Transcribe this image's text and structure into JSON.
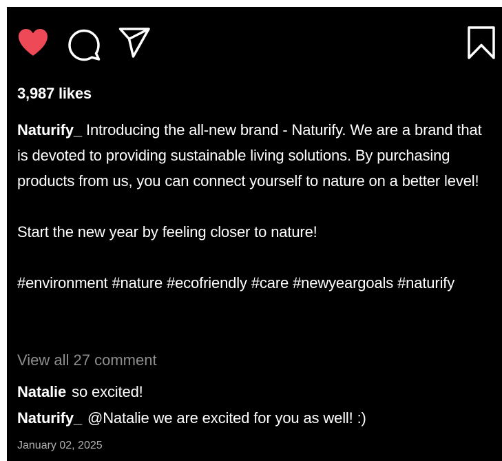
{
  "post": {
    "colors": {
      "background": "#000000",
      "text": "#ffffff",
      "muted": "#8e8e8e",
      "heart": "#ed4956"
    },
    "actions": {
      "like_icon": "heart-icon",
      "liked": true,
      "comment_icon": "comment-bubble-icon",
      "share_icon": "paper-plane-icon",
      "save_icon": "bookmark-icon"
    },
    "likes_text": "3,987 likes",
    "caption": {
      "username": "Naturify_",
      "paragraph_1": "Introducing the all-new brand - Naturify. We are a brand that is devoted to providing sustainable living solutions. By purchasing products from us, you can connect yourself to nature on a better level!",
      "paragraph_2": "Start the new year by feeling closer to nature!",
      "hashtags": [
        "#environment",
        "#nature",
        "#ecofriendly",
        "#care",
        "#newyeargoals",
        "#naturify"
      ]
    },
    "view_all_comments": "View all 27 comment",
    "comments": [
      {
        "username": "Natalie",
        "text": "so excited!"
      },
      {
        "username": "Naturify_",
        "text": "@Natalie we are excited for you as well! :)"
      }
    ],
    "date": "January 02, 2025"
  }
}
